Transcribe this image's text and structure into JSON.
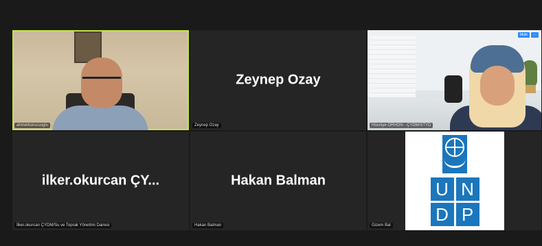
{
  "tiles": [
    {
      "name": "ahmetkorucuoglu",
      "kind": "video",
      "speaking": true
    },
    {
      "name": "Zeynep Ozay",
      "display_name": "Zeynep Ozay",
      "kind": "name"
    },
    {
      "name": "Hüsniye ORHON - ÇYDM/STYD",
      "kind": "video",
      "badges": [
        "Mute",
        "···"
      ]
    },
    {
      "name": "İlker.okurcan ÇYDM/Su ve Toprak Yönetimi Dairesi",
      "display_name": "ilker.okurcan  ÇY...",
      "kind": "name"
    },
    {
      "name": "Hakan Balman",
      "display_name": "Hakan Balman",
      "kind": "name"
    },
    {
      "name": "Gizem Bal",
      "kind": "logo",
      "logo_letters": [
        "U",
        "N",
        "D",
        "P"
      ]
    }
  ],
  "colors": {
    "speaking_border": "#c6e34a",
    "tile_bg": "#252525",
    "undp_blue": "#1a76bd"
  },
  "icons": {
    "logo": "un-emblem-icon"
  }
}
